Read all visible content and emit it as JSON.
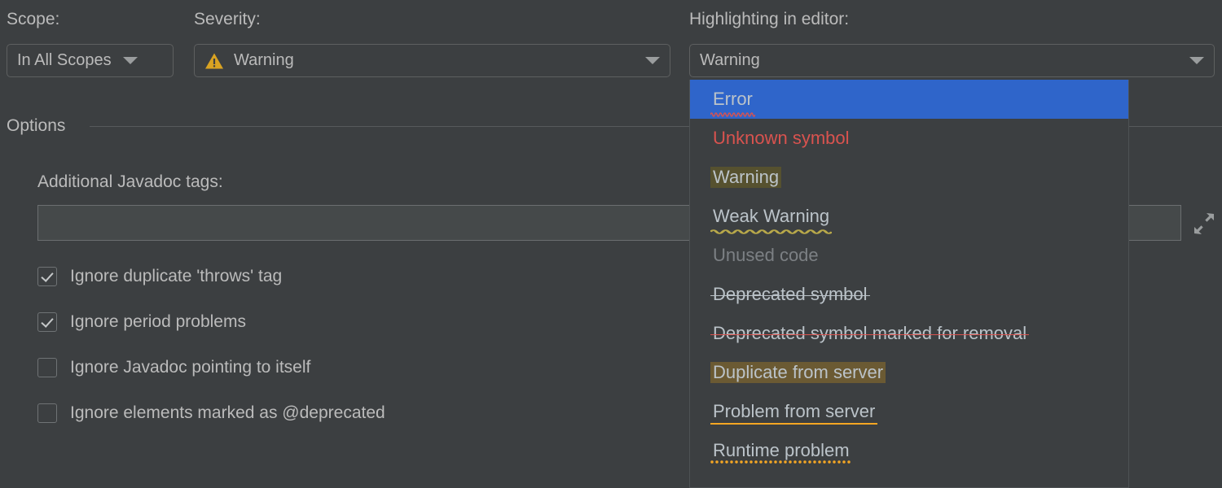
{
  "fields": {
    "scope": {
      "label": "Scope:",
      "value": "In All Scopes",
      "dropdown_icon": "chevron-down-icon"
    },
    "severity": {
      "label": "Severity:",
      "value": "Warning",
      "icon": "warning-triangle-icon",
      "dropdown_icon": "chevron-down-icon"
    },
    "highlighting": {
      "label": "Highlighting in editor:",
      "value": "Warning",
      "dropdown_icon": "chevron-down-icon"
    }
  },
  "options": {
    "title": "Options",
    "javadoc_tags": {
      "label": "Additional Javadoc tags:",
      "value": "",
      "placeholder": "",
      "expand_icon": "expand-arrows-icon"
    },
    "checkboxes": [
      {
        "label": "Ignore duplicate 'throws' tag",
        "checked": true
      },
      {
        "label": "Ignore period problems",
        "checked": true
      },
      {
        "label": "Ignore Javadoc pointing to itself",
        "checked": false
      },
      {
        "label": "Ignore elements marked as @deprecated",
        "checked": false
      }
    ]
  },
  "dropdown": {
    "open": true,
    "selected_index": 0,
    "items": [
      {
        "label": "Error",
        "style": "plain",
        "decoration": "squiggle-red",
        "selected": true
      },
      {
        "label": "Unknown symbol",
        "style": "red-text",
        "decoration": "none",
        "selected": false
      },
      {
        "label": "Warning",
        "style": "hl-olive",
        "decoration": "none",
        "selected": false
      },
      {
        "label": "Weak Warning",
        "style": "plain",
        "decoration": "squiggle-yellow",
        "selected": false
      },
      {
        "label": "Unused code",
        "style": "gray-text",
        "decoration": "none",
        "selected": false
      },
      {
        "label": "Deprecated symbol",
        "style": "strike-gray",
        "decoration": "none",
        "selected": false
      },
      {
        "label": "Deprecated symbol marked for removal",
        "style": "strike-red",
        "decoration": "none",
        "selected": false
      },
      {
        "label": "Duplicate from server",
        "style": "hl-brown",
        "decoration": "none",
        "selected": false
      },
      {
        "label": "Problem from server",
        "style": "plain",
        "decoration": "underline-solid-orange",
        "selected": false
      },
      {
        "label": "Runtime problem",
        "style": "plain",
        "decoration": "underline-dotted-orange",
        "selected": false
      }
    ]
  },
  "colors": {
    "background": "#3c3f41",
    "selection_blue": "#2f65ca",
    "text": "#bbbbbb",
    "error_red": "#d9534f",
    "warning_amber": "#d9a322",
    "highlight_olive": "#56512f",
    "highlight_brown": "#6b5a33",
    "server_orange": "#f5a623",
    "disabled_gray": "#7c8084"
  }
}
